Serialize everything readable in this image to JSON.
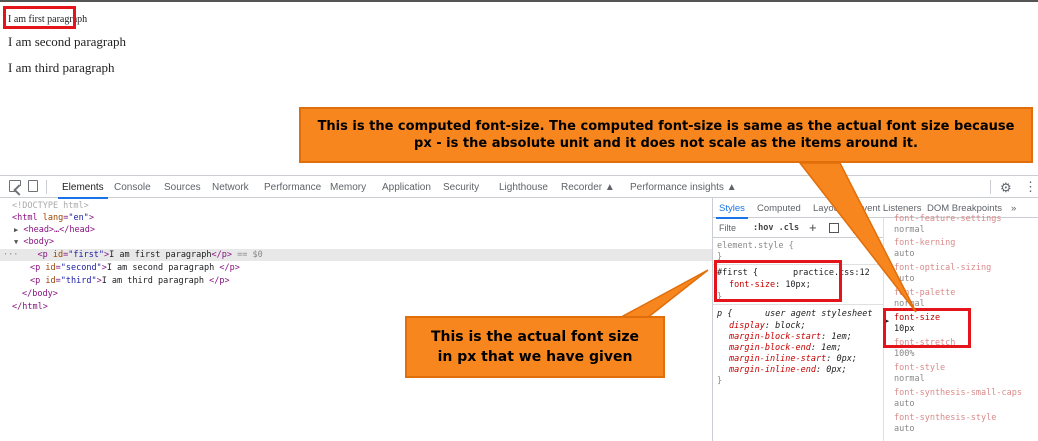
{
  "page": {
    "paragraphs": [
      "I am first paragraph",
      "I am second paragraph",
      "I am third paragraph"
    ]
  },
  "devtools": {
    "tabs": [
      "Elements",
      "Console",
      "Sources",
      "Network",
      "Performance",
      "Memory",
      "Application",
      "Security",
      "Lighthouse",
      "Recorder ▲",
      "Performance insights ▲"
    ],
    "active_tab": "Elements",
    "dom": {
      "doctype": "<!DOCTYPE html>",
      "html_open_tag": "<html",
      "html_lang_attr": "lang",
      "html_lang_val": "\"en\"",
      "head_collapsed": "<head>…</head>",
      "body_open": "<body>",
      "p_first_id": "\"first\"",
      "p_first_text": "I am first paragraph",
      "p_second_id": "\"second\"",
      "p_second_text": "I am second paragraph ",
      "p_third_id": "\"third\"",
      "p_third_text": "I am third paragraph ",
      "body_close": "</body>",
      "html_close": "</html>",
      "selected_marker": "== $0",
      "ellipsis": "···"
    },
    "styles": {
      "tabs": [
        "Styles",
        "Computed",
        "Layout",
        "Event Listeners",
        "DOM Breakpoints",
        "»"
      ],
      "active_tab": "Styles",
      "filter_placeholder": "Filte",
      "hov_cls": ":hov .cls",
      "element_style": "element.style {",
      "close_brace": "}",
      "first_rule": {
        "selector": "#first {",
        "source": "practice.css:12",
        "prop": "font-size",
        "value": "10px;"
      },
      "ua_rule": {
        "selector": "p {",
        "source": "user agent stylesheet",
        "props": [
          {
            "prop": "display",
            "value": "block;"
          },
          {
            "prop": "margin-block-start",
            "value": "1em;"
          },
          {
            "prop": "margin-block-end",
            "value": "1em;"
          },
          {
            "prop": "margin-inline-start",
            "value": "0px;"
          },
          {
            "prop": "margin-inline-end",
            "value": "0px;"
          }
        ]
      }
    },
    "computed": [
      {
        "name": "font-feature-settings",
        "value": "normal"
      },
      {
        "name": "font-kerning",
        "value": "auto"
      },
      {
        "name": "font-optical-sizing",
        "value": "auto"
      },
      {
        "name": "font-palette",
        "value": "normal"
      },
      {
        "name": "font-size",
        "value": "10px"
      },
      {
        "name": "font-stretch",
        "value": "100%"
      },
      {
        "name": "font-style",
        "value": "normal"
      },
      {
        "name": "font-synthesis-small-caps",
        "value": "auto"
      },
      {
        "name": "font-synthesis-style",
        "value": "auto"
      }
    ]
  },
  "annotations": {
    "computed_callout": "This is the computed font-size. The computed font-size is same as the actual font size because px - is the absolute unit and it does not scale as the items around it.",
    "actual_callout": "This is the actual font size in px that we have given",
    "callout_color": "#f7861f",
    "highlight_color": "#e4141b"
  }
}
